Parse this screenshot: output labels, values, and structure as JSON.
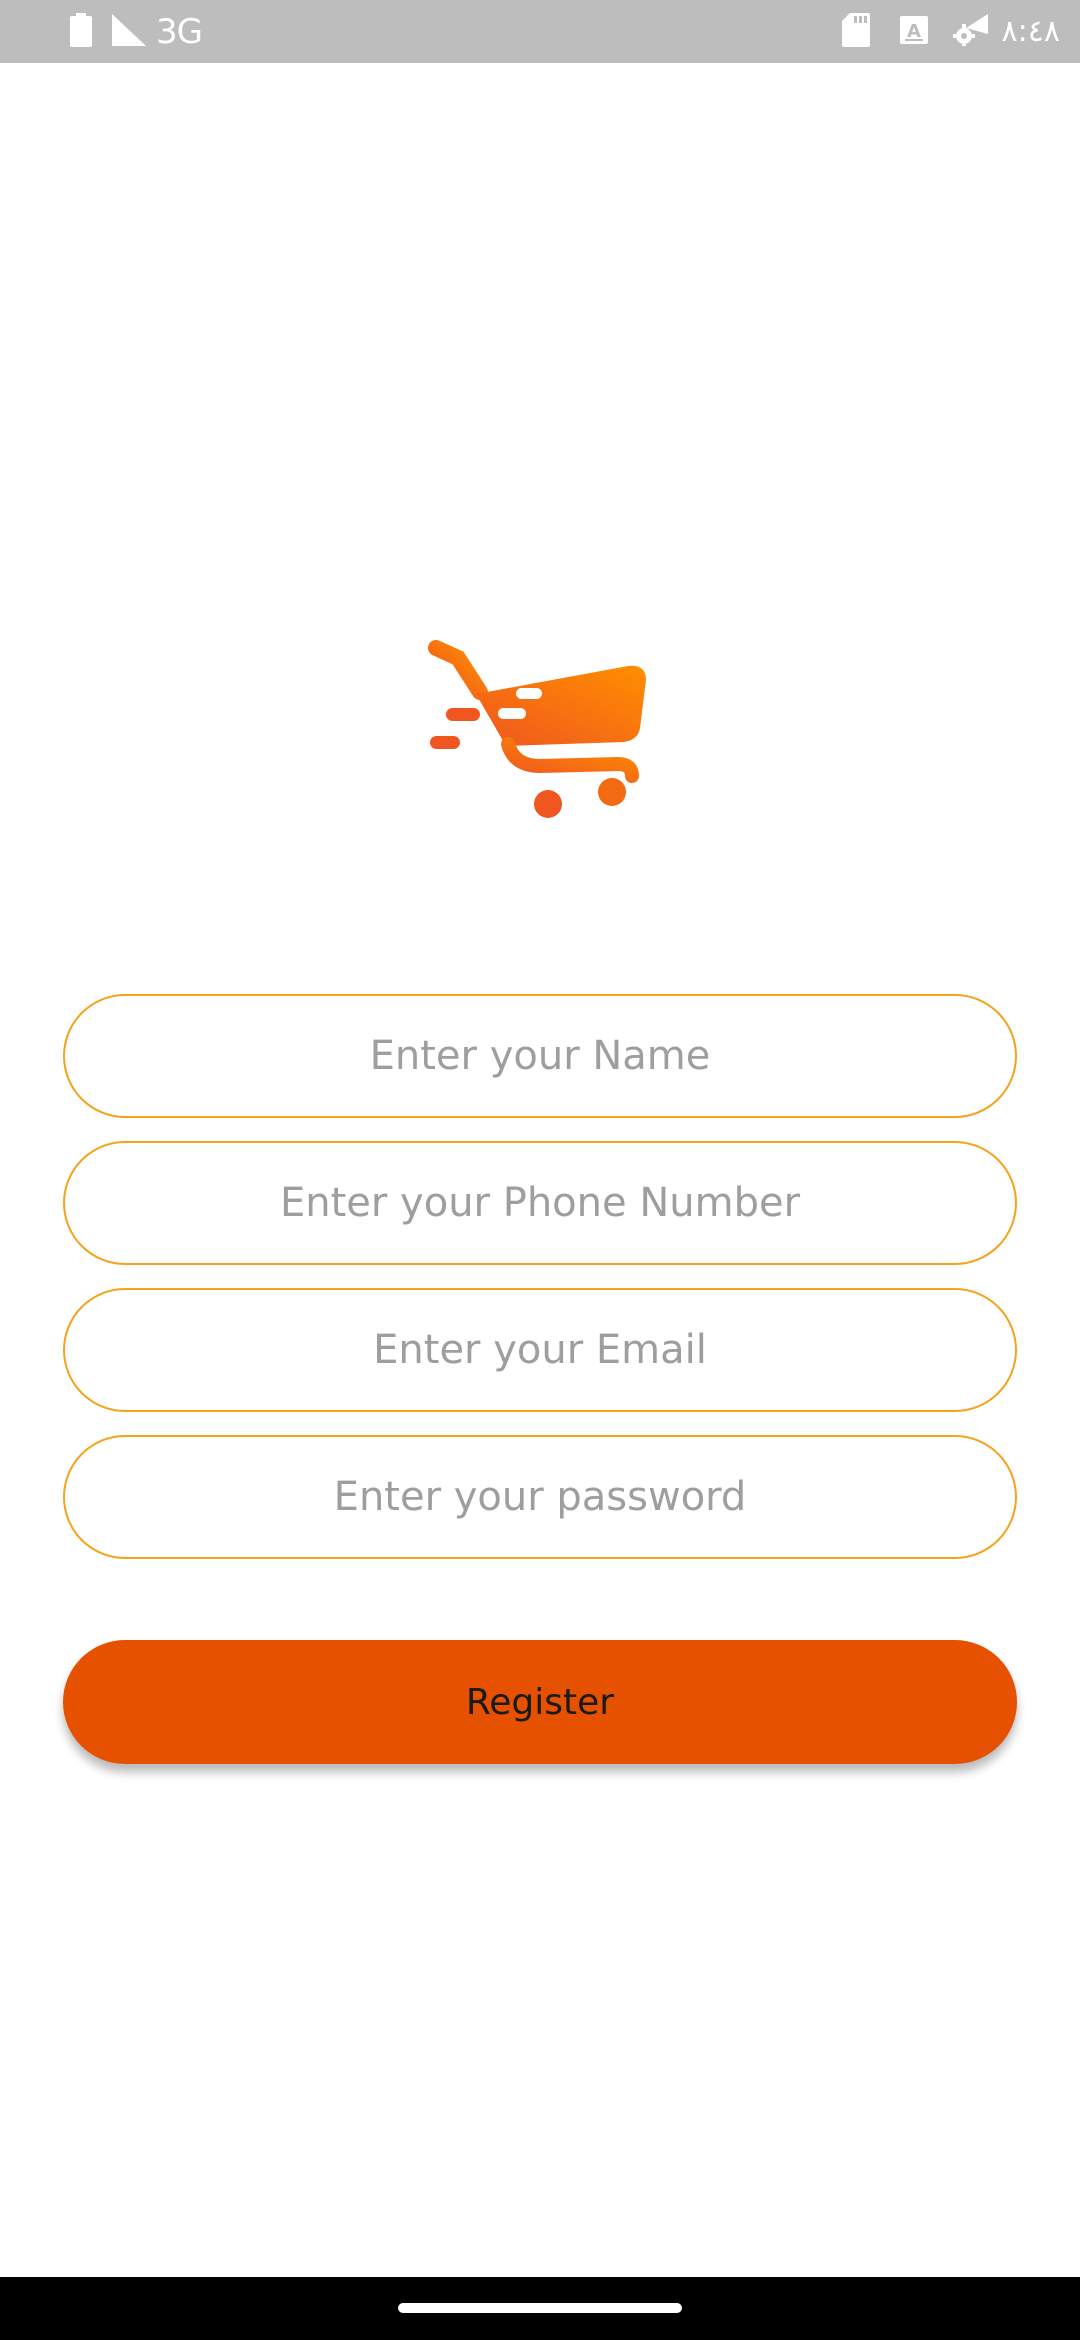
{
  "status_bar": {
    "network_type": "3G",
    "time": "٨:٤٨",
    "icons": [
      "battery-icon",
      "signal-icon",
      "sd-card-icon",
      "keyboard-a-icon",
      "settings-wifi-icon"
    ]
  },
  "logo": {
    "icon": "shopping-cart-icon",
    "colors": [
      "#f0561f",
      "#ff8f00"
    ]
  },
  "form": {
    "name_placeholder": "Enter your Name",
    "phone_placeholder": "Enter your Phone Number",
    "email_placeholder": "Enter your Email",
    "password_placeholder": "Enter your password",
    "field_border_color": "#f7a21b"
  },
  "register_button": {
    "label": "Register",
    "color": "#e65100"
  }
}
